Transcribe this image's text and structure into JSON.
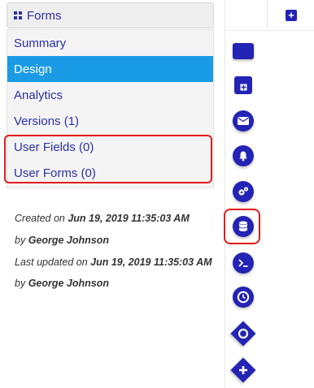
{
  "sidebar": {
    "header": "Forms",
    "items": [
      {
        "label": "Summary",
        "active": false
      },
      {
        "label": "Design",
        "active": true
      },
      {
        "label": "Analytics",
        "active": false
      },
      {
        "label": "Versions (1)",
        "active": false
      },
      {
        "label": "User Fields (0)",
        "active": false
      },
      {
        "label": "User Forms (0)",
        "active": false
      }
    ]
  },
  "meta": {
    "created_prefix": "Created on",
    "created_date": "Jun 19, 2019 11:35:03 AM",
    "by_prefix": "by",
    "created_by": "George Johnson",
    "updated_prefix": "Last updated on",
    "updated_date": "Jun 19, 2019 11:35:03 AM",
    "updated_by": "George Johnson"
  },
  "toolbar": {
    "add_tab_symbol": "+",
    "tools": [
      "rectangle-icon",
      "subprocess-icon",
      "envelope-icon",
      "bell-icon",
      "gears-icon",
      "database-icon",
      "terminal-icon",
      "clock-icon",
      "gateway-circle-icon",
      "gateway-plus-icon"
    ]
  },
  "colors": {
    "accent": "#2323b5",
    "link": "#2a2fa8",
    "active_bg": "#1a9be6",
    "highlight": "#e11b1b"
  }
}
